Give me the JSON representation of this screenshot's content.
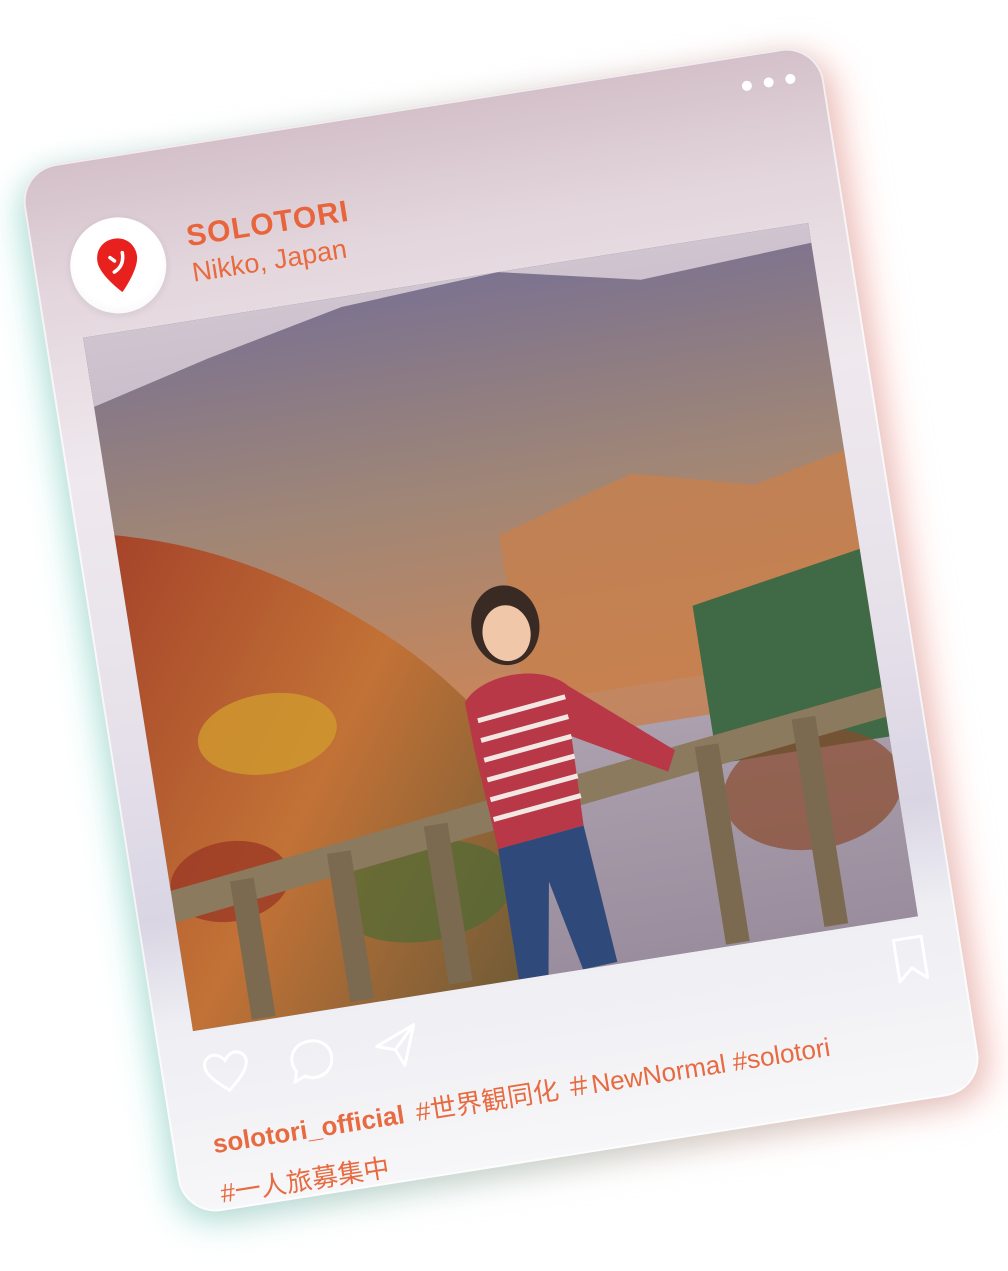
{
  "post": {
    "account_name": "SOLOTORI",
    "location": "Nikko, Japan",
    "username": "solotori_official",
    "hashtags_line1": "#世界観同化 ＃NewNormal #solotori",
    "hashtags_line2": "#一人旅募集中"
  },
  "icons": {
    "menu": "more-dots-icon",
    "avatar": "location-pin-icon",
    "like": "heart-icon",
    "comment": "comment-bubble-icon",
    "share": "send-icon",
    "save": "bookmark-icon"
  },
  "colors": {
    "accent": "#e8643c",
    "pin": "#e8201e",
    "icon_outline": "#ffffff"
  }
}
